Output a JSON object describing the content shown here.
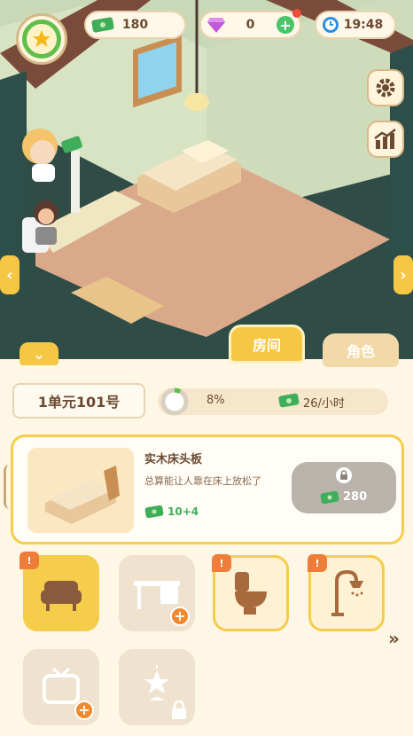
{
  "hud": {
    "cash": "180",
    "gems": "0",
    "time": "19:48"
  },
  "tabs": [
    {
      "label": "房间"
    },
    {
      "label": "角色"
    }
  ],
  "room": {
    "name": "1单元101号",
    "progress_text": "8%",
    "progress_value": 0.08,
    "income": "26/小时"
  },
  "item": {
    "title": "实木床头板",
    "description": "总算能让人靠在床上放松了",
    "reward": "10+4",
    "price": "280"
  },
  "slots": [
    {
      "icon": "sofa-icon",
      "badge": "!"
    },
    {
      "icon": "desk-icon",
      "badge": ""
    },
    {
      "icon": "toilet-icon",
      "badge": "!"
    },
    {
      "icon": "shower-icon",
      "badge": "!"
    },
    {
      "icon": "tv-icon",
      "badge": ""
    },
    {
      "icon": "lamp-icon",
      "badge": ""
    }
  ],
  "colors": {
    "accent": "#f6cd4b",
    "cash_green": "#3fae5a",
    "panel_bg": "#fff7e6",
    "badge_orange": "#ef7d3a"
  }
}
